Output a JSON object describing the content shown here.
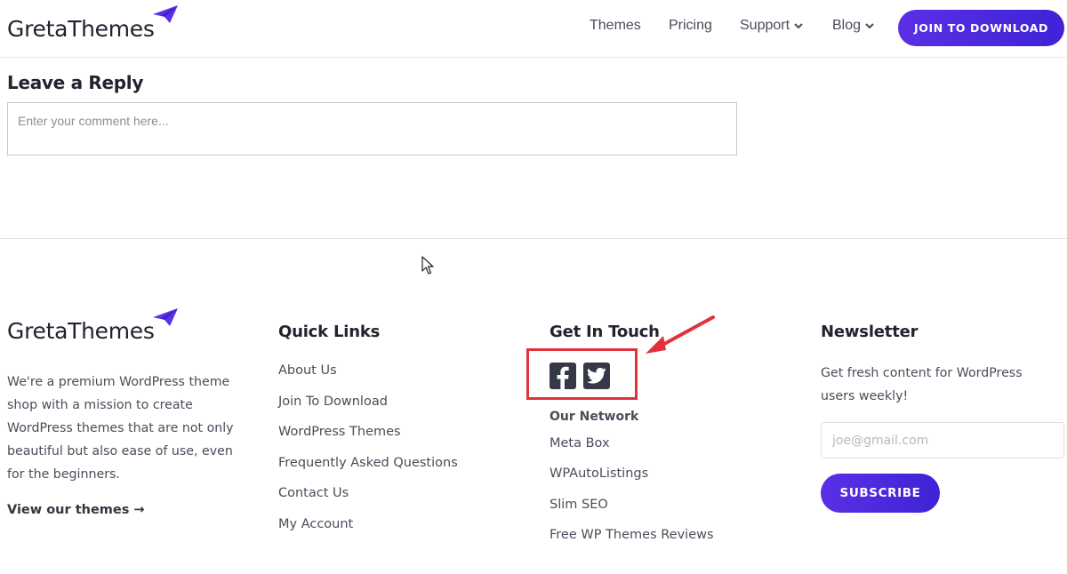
{
  "header": {
    "logo_text": "GretaThemes",
    "nav": [
      {
        "label": "Themes"
      },
      {
        "label": "Pricing"
      },
      {
        "label": "Support"
      },
      {
        "label": "Blog"
      }
    ],
    "cta_label": "JOIN TO DOWNLOAD"
  },
  "reply": {
    "title": "Leave a Reply",
    "placeholder": "Enter your comment here..."
  },
  "footer": {
    "logo_text": "GretaThemes",
    "about": "We're a premium WordPress theme shop with a mission to create WordPress themes that are not only beautiful but also ease of use, even for the beginners.",
    "view_link": "View our themes →",
    "quick_links": {
      "title": "Quick Links",
      "items": [
        "About Us",
        "Join To Download",
        "WordPress Themes",
        "Frequently Asked Questions",
        "Contact Us",
        "My Account"
      ]
    },
    "touch": {
      "title": "Get In Touch",
      "social": [
        "facebook-icon",
        "twitter-icon"
      ],
      "network_title": "Our Network",
      "network": [
        "Meta Box",
        "WPAutoListings",
        "Slim SEO",
        "Free WP Themes Reviews"
      ]
    },
    "newsletter": {
      "title": "Newsletter",
      "text": "Get fresh content for WordPress users weekly!",
      "placeholder": "joe@gmail.com",
      "button": "SUBSCRIBE"
    }
  },
  "colors": {
    "accent": "#4a28dd",
    "highlight": "#e0323a",
    "text": "#4a4d5a"
  }
}
